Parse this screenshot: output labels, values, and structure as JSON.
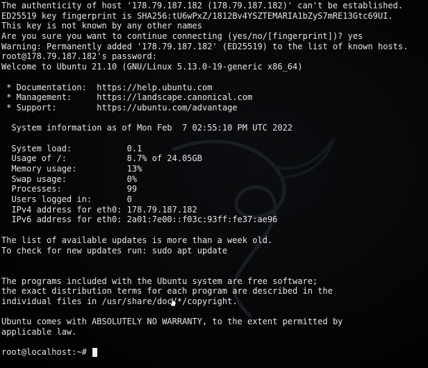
{
  "terminal": {
    "lines": [
      "The authenticity of host '178.79.187.182 (178.79.187.182)' can't be established.",
      "ED25519 key fingerprint is SHA256:tU6wPxZ/1812Bv4YSZTEMARIA1bZyS7mRE13Gtc69UI.",
      "This key is not known by any other names",
      "Are you sure you want to continue connecting (yes/no/[fingerprint])? yes",
      "Warning: Permanently added '178.79.187.182' (ED25519) to the list of known hosts.",
      "root@178.79.187.182's password:",
      "Welcome to Ubuntu 21.10 (GNU/Linux 5.13.0-19-generic x86_64)",
      "",
      " * Documentation:  https://help.ubuntu.com",
      " * Management:     https://landscape.canonical.com",
      " * Support:        https://ubuntu.com/advantage",
      "",
      "  System information as of Mon Feb  7 02:55:10 PM UTC 2022",
      "",
      "  System load:           0.1",
      "  Usage of /:            8.7% of 24.05GB",
      "  Memory usage:          13%",
      "  Swap usage:            0%",
      "  Processes:             99",
      "  Users logged in:       0",
      "  IPv4 address for eth0: 178.79.187.182",
      "  IPv6 address for eth0: 2a01:7e00::f03c:93ff:fe37:ae96",
      "",
      "The list of available updates is more than a week old.",
      "To check for new updates run: sudo apt update",
      "",
      "",
      "The programs included with the Ubuntu system are free software;",
      "the exact distribution terms for each program are described in the",
      "individual files in /usr/share/doc/*/copyright.",
      "",
      "Ubuntu comes with ABSOLUTELY NO WARRANTY, to the extent permitted by",
      "applicable law.",
      ""
    ],
    "prompt": "root@localhost:~# ",
    "colors": {
      "background": "#000000",
      "text": "#e6e6e6",
      "cursor": "#f0f0f0"
    }
  }
}
